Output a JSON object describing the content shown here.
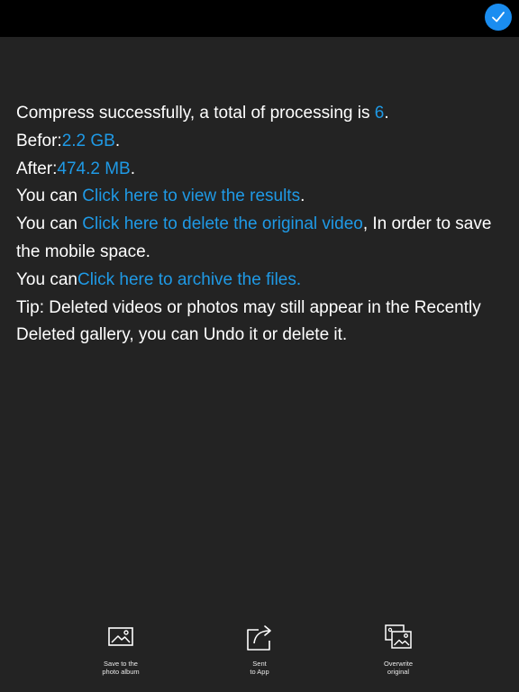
{
  "header": {
    "done_icon": "checkmark-icon",
    "accent_color": "#1a8df0"
  },
  "message": {
    "line1_text": "Compress successfully, a total of processing is ",
    "total_count": "6",
    "line1_end": ".",
    "before_label": "Befor:",
    "before_value": "2.2 GB",
    "before_end": ".",
    "after_label": "After:",
    "after_value": "474.2 MB",
    "after_end": ".",
    "view_prefix": "You can ",
    "view_link": "Click here to view the results",
    "view_end": ".",
    "delete_prefix": "You can ",
    "delete_link": "Click here to delete the original video",
    "delete_suffix": ", In order to save the mobile space.",
    "archive_prefix": "You can",
    "archive_link": "Click here to archive the files.",
    "tip": "Tip: Deleted videos or photos may still appear in the Recently Deleted gallery, you can Undo it or delete it.",
    "accent_color": "#1f9ae6"
  },
  "actions": [
    {
      "icon": "photo-album-icon",
      "label": "Save to the\nphoto album"
    },
    {
      "icon": "share-icon",
      "label": "Sent\nto App"
    },
    {
      "icon": "overwrite-photos-icon",
      "label": "Overwrite\noriginal"
    }
  ]
}
